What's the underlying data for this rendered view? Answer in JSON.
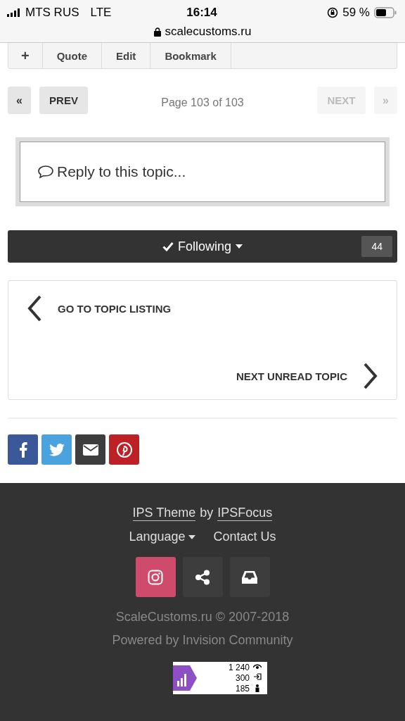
{
  "status_bar": {
    "carrier": "MTS RUS",
    "network": "LTE",
    "time": "16:14",
    "battery": "59 %"
  },
  "browser": {
    "url": "scalecustoms.ru"
  },
  "post_toolbar": {
    "buttons": [
      "+",
      "Quote",
      "Edit",
      "Bookmark"
    ]
  },
  "pagination": {
    "first": {
      "label": "«",
      "disabled": false
    },
    "prev": {
      "label": "PREV",
      "disabled": false
    },
    "page_info": "Page 103 of 103",
    "next": {
      "label": "NEXT",
      "disabled": true
    },
    "last": {
      "label": "»",
      "disabled": true
    }
  },
  "reply": {
    "placeholder": "Reply to this topic..."
  },
  "follow": {
    "label": "Following",
    "following": true,
    "count": "44"
  },
  "topic_nav": {
    "back": "GO TO TOPIC LISTING",
    "next": "NEXT UNREAD TOPIC"
  },
  "share": [
    {
      "kind": "facebook",
      "color": "#3b5998"
    },
    {
      "kind": "twitter",
      "color": "#4aa3df"
    },
    {
      "kind": "email",
      "color": "#3d3d3d"
    },
    {
      "kind": "pinterest",
      "color": "#bd2126"
    }
  ],
  "footer": {
    "theme_link": "IPS Theme",
    "theme_by": "by",
    "author_link": "IPSFocus",
    "links": [
      "Language",
      "Contact Us"
    ],
    "social": [
      {
        "kind": "instagram",
        "color": "#cf4b6b"
      },
      {
        "kind": "share",
        "color": "#3d3d3d"
      },
      {
        "kind": "inbox",
        "color": "#3d3d3d"
      }
    ],
    "copyright": "ScaleCustoms.ru © 2007-2018",
    "powered": "Powered by Invision Community",
    "counter": [
      "1 240",
      "300",
      "185"
    ]
  }
}
